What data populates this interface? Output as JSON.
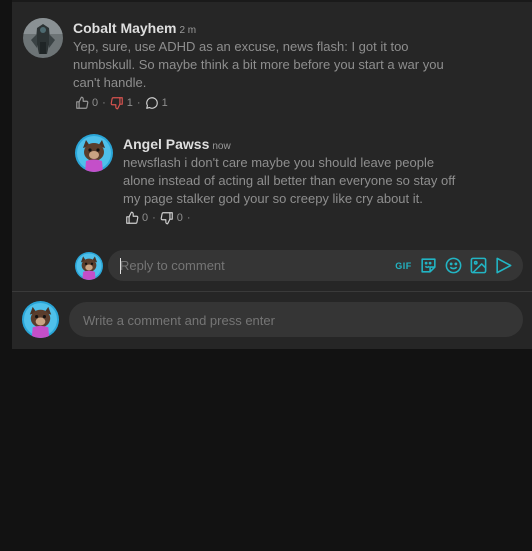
{
  "comment": {
    "username": "Cobalt Mayhem",
    "time": "2 m",
    "lines": [
      "Yep, sure, use ADHD as an excuse, news flash: I got it too",
      "numbskull. So maybe think a bit more before you start a war you",
      "can't handle."
    ],
    "likes": "0",
    "dislikes": "1",
    "replies": "1",
    "dot": "·"
  },
  "reply": {
    "username": "Angel Pawss",
    "time": "now",
    "lines": [
      "newsflash i don't care maybe you should leave people",
      "alone instead of acting all better than everyone so stay off",
      "my page stalker god your so creepy like cry about it."
    ],
    "likes": "0",
    "dislikes": "0",
    "dot": "·"
  },
  "reply_box": {
    "placeholder": "Reply to comment",
    "gif_label": "GIF",
    "icons": [
      "gif-icon",
      "sticker-icon",
      "emoji-icon",
      "image-icon",
      "send-icon"
    ]
  },
  "comment_box": {
    "placeholder": "Write a comment and press enter"
  },
  "colors": {
    "accent": "#22b5c4",
    "dislike_active": "#d9534f"
  }
}
